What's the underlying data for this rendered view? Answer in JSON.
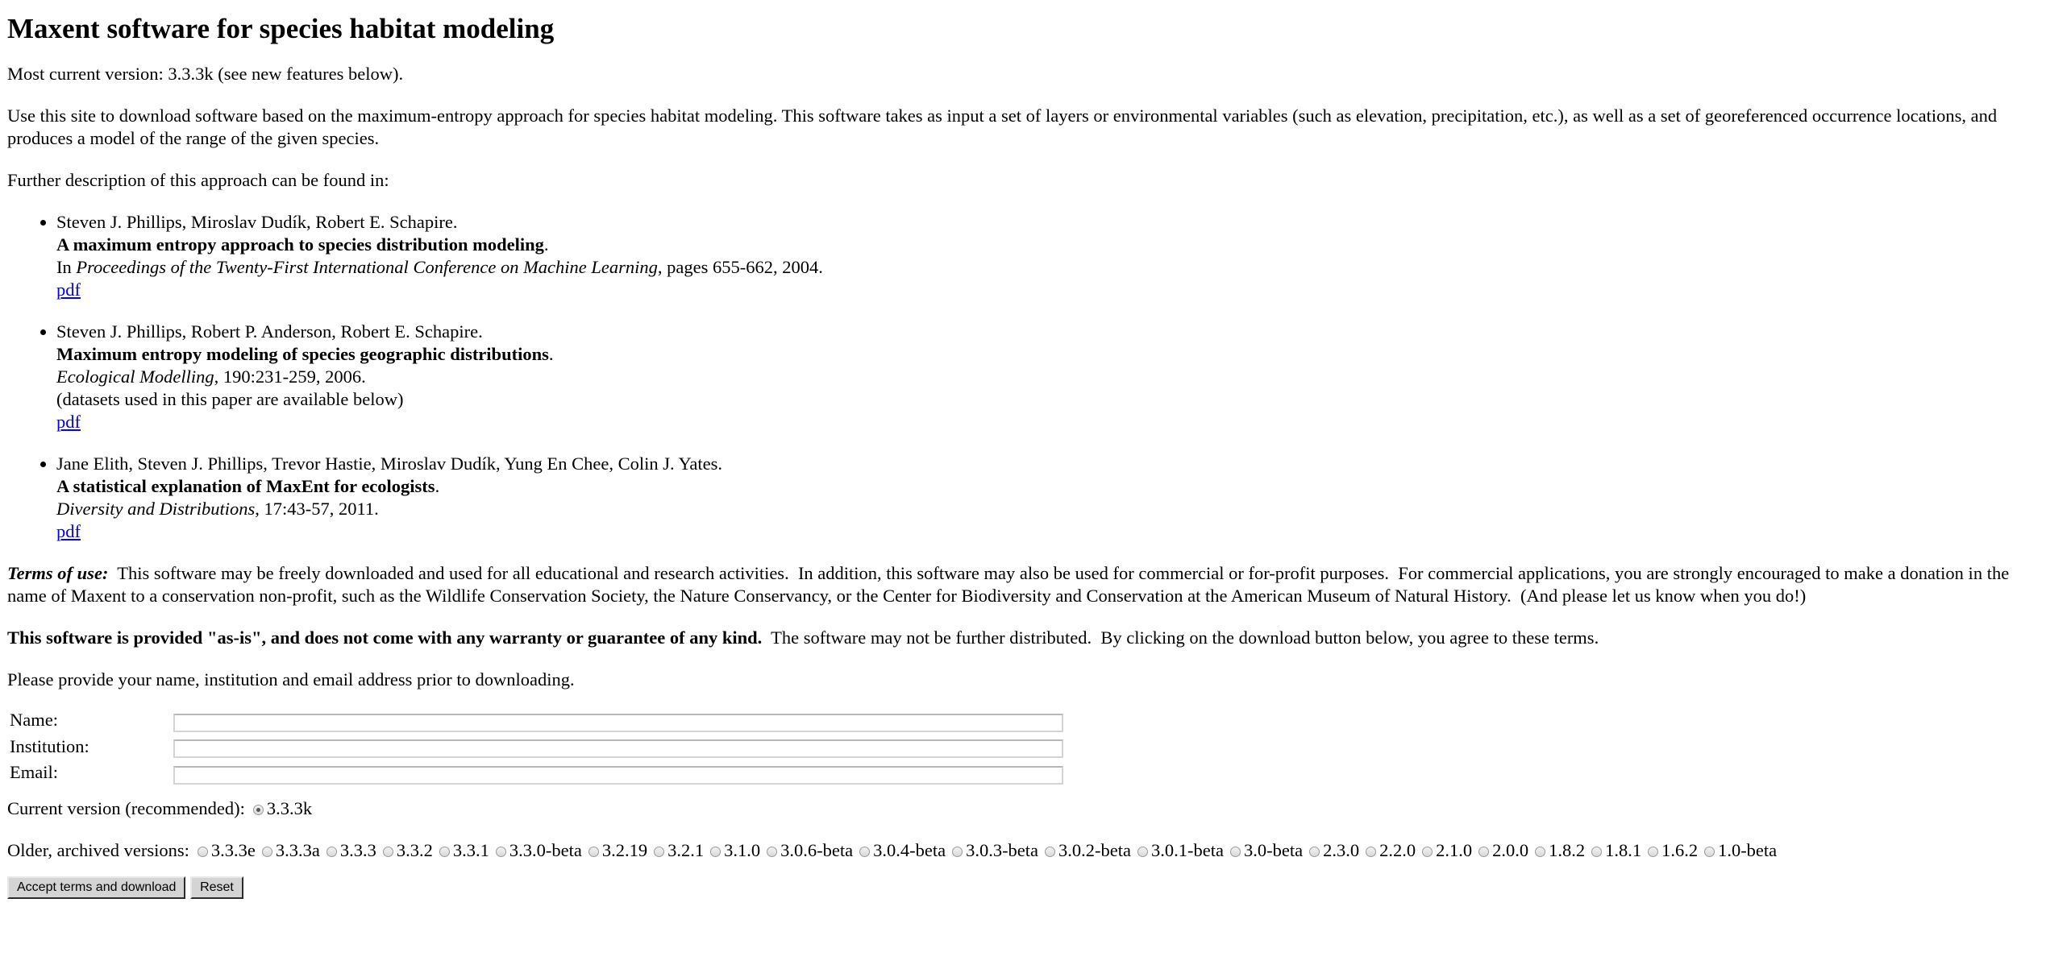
{
  "page": {
    "heading": "Maxent software for species habitat modeling",
    "version_line": "Most current version: 3.3.3k (see new features below).",
    "intro": "Use this site to download software based on the maximum-entropy approach for species habitat modeling.  This software takes as input a set of layers or environmental variables (such as elevation, precipitation, etc.), as well as a set of georeferenced occurrence locations, and produces a model of the range of the given species.",
    "further": "Further description of this approach can be found in:"
  },
  "references": [
    {
      "authors": "Steven J. Phillips, Miroslav Dudík, Robert E. Schapire.",
      "title": "A maximum entropy approach to species distribution modeling",
      "title_end": ".",
      "venue_prefix": "In ",
      "venue": "Proceedings of the Twenty-First International Conference on Machine Learning",
      "venue_suffix": ", pages 655-662, 2004.",
      "note": "",
      "link": "pdf"
    },
    {
      "authors": "Steven J. Phillips, Robert P. Anderson, Robert E. Schapire.",
      "title": "Maximum entropy modeling of species geographic distributions",
      "title_end": ".",
      "venue_prefix": "",
      "venue": "Ecological Modelling",
      "venue_suffix": ", 190:231-259, 2006.",
      "note": "(datasets used in this paper are available below)",
      "link": "pdf"
    },
    {
      "authors": "Jane Elith, Steven J. Phillips, Trevor Hastie, Miroslav Dudík, Yung En Chee, Colin J. Yates.",
      "title": "A statistical explanation of MaxEnt for ecologists",
      "title_end": ".",
      "venue_prefix": "",
      "venue": "Diversity and Distributions",
      "venue_suffix": ", 17:43-57, 2011.",
      "note": "",
      "link": "pdf"
    }
  ],
  "terms": {
    "label": "Terms of use:",
    "text": "  This software may be freely downloaded and used for all educational and research activities.  In addition, this software may also be used for commercial or for-profit purposes.  For commercial applications, you are strongly encouraged to make a donation in the name of Maxent to a conservation non-profit, such as the Wildlife Conservation Society, the Nature Conservancy, or the Center for Biodiversity and Conservation at the American Museum of Natural History.  (And please let us know when you do!)",
    "warranty_bold": "This software is provided \"as-is\", and does not come with any warranty or guarantee of any kind.",
    "warranty_rest": "  The software may not be further distributed.  By clicking on the download button below, you agree to these terms.",
    "provide": "Please provide your name, institution and email address prior to downloading."
  },
  "form": {
    "name_label": "Name:",
    "name_value": "",
    "institution_label": "Institution:",
    "institution_value": "",
    "email_label": "Email:",
    "email_value": ""
  },
  "versions": {
    "current_label": "Current version (recommended):",
    "current": "3.3.3k",
    "current_selected": true,
    "older_label": "Older, archived versions:",
    "older": [
      "3.3.3e",
      "3.3.3a",
      "3.3.3",
      "3.3.2",
      "3.3.1",
      "3.3.0-beta",
      "3.2.19",
      "3.2.1",
      "3.1.0",
      "3.0.6-beta",
      "3.0.4-beta",
      "3.0.3-beta",
      "3.0.2-beta",
      "3.0.1-beta",
      "3.0-beta",
      "2.3.0",
      "2.2.0",
      "2.1.0",
      "2.0.0",
      "1.8.2",
      "1.8.1",
      "1.6.2",
      "1.0-beta"
    ]
  },
  "buttons": {
    "accept_label": "Accept terms and download",
    "reset_label": "Reset"
  }
}
